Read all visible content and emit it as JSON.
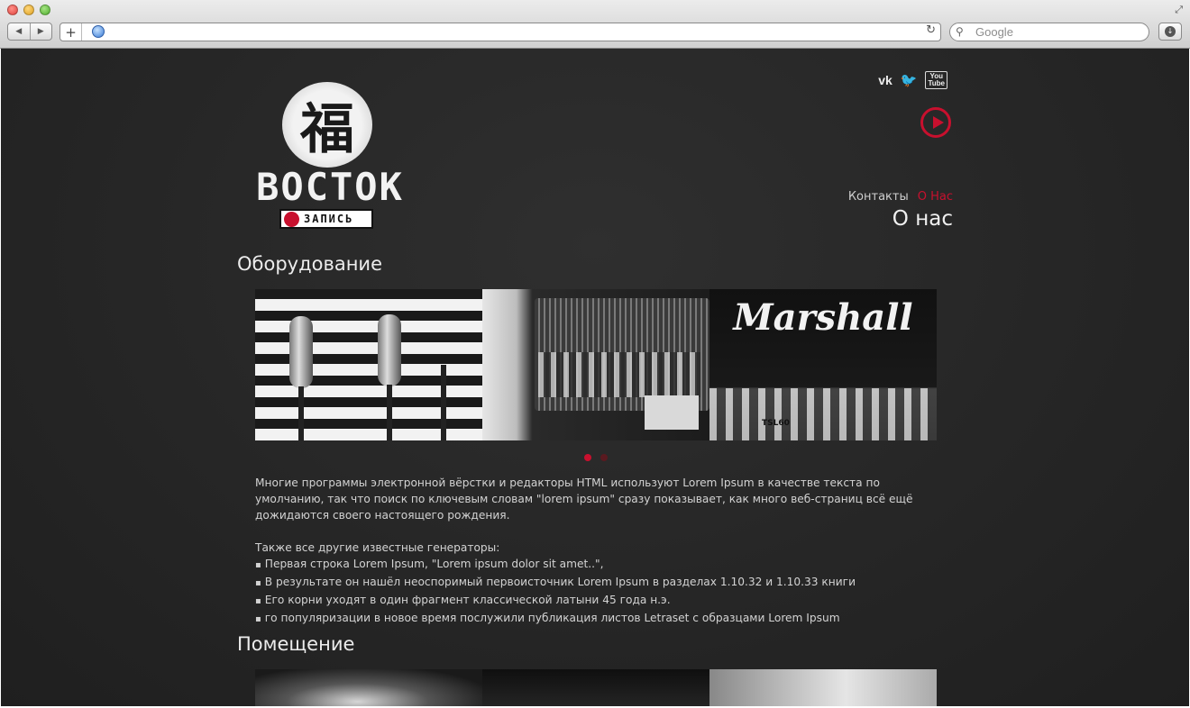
{
  "browser": {
    "search_placeholder": "Google",
    "nav_back": "◀",
    "nav_forward": "▶",
    "add_tab": "+",
    "reload": "↻",
    "search_icon": "⚲",
    "downloads_icon": "↓",
    "resize_icon": "⤢"
  },
  "logo": {
    "glyph": "福",
    "word": "ВОСТОК",
    "sub": "ЗАПИСЬ"
  },
  "social": {
    "vk": "vk",
    "twitter": "🐦",
    "youtube_top": "You",
    "youtube_bottom": "Tube"
  },
  "nav": {
    "contacts": "Контакты",
    "about": "О Нас"
  },
  "page_title": "О нас",
  "sections": {
    "equipment_title": "Оборудование",
    "room_title": "Помещение"
  },
  "photos": {
    "marshall_brand": "Marshall",
    "marshall_model": "TSL60"
  },
  "content": {
    "para1": "Многие программы электронной вёрстки и редакторы HTML используют Lorem Ipsum в качестве текста по умолчанию, так что поиск по ключевым словам \"lorem ipsum\" сразу показывает, как много веб-страниц всё ещё дожидаются своего настоящего рождения.",
    "list_intro": "Также все другие известные генераторы:",
    "items": [
      "Первая строка Lorem Ipsum, \"Lorem ipsum dolor sit amet..\",",
      "В результате он нашёл неоспоримый первоисточник Lorem Ipsum в разделах 1.10.32 и 1.10.33 книги",
      "Его корни уходят в один фрагмент классической латыни 45 года н.э.",
      "го популяризации в новое время послужили публикация листов Letraset с образцами Lorem Ipsum"
    ]
  },
  "colors": {
    "accent": "#c8102e",
    "background": "#262626"
  }
}
